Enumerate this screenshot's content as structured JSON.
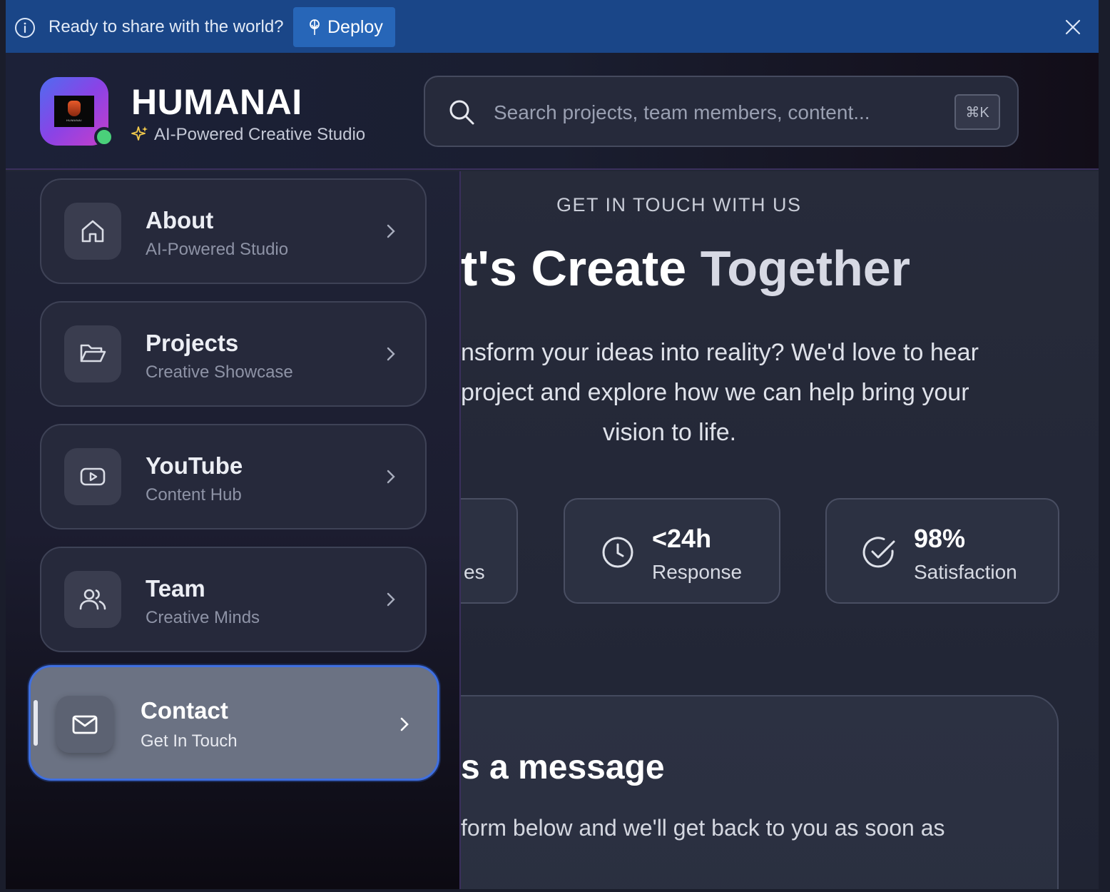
{
  "banner": {
    "text": "Ready to share with the world?",
    "deploy_label": "Deploy"
  },
  "header": {
    "brand_title": "HUMANAI",
    "brand_subtitle": "AI-Powered Creative Studio",
    "logo_text": "HUMANAI",
    "search_placeholder": "Search projects, team members, content...",
    "shortcut": "⌘K"
  },
  "sidebar": {
    "items": [
      {
        "label": "About",
        "sub": "AI-Powered Studio",
        "icon": "home-icon"
      },
      {
        "label": "Projects",
        "sub": "Creative Showcase",
        "icon": "folder-icon"
      },
      {
        "label": "YouTube",
        "sub": "Content Hub",
        "icon": "youtube-icon"
      },
      {
        "label": "Team",
        "sub": "Creative Minds",
        "icon": "users-icon"
      },
      {
        "label": "Contact",
        "sub": "Get In Touch",
        "icon": "mail-icon",
        "active": true
      }
    ]
  },
  "main": {
    "eyebrow": "GET IN TOUCH WITH US",
    "hero_title_a": "t's Create ",
    "hero_title_b": "Together",
    "hero_lines": [
      "nsform your ideas into reality? We'd love to hear",
      "project and explore how we can help bring your",
      "vision to life."
    ],
    "stats": [
      {
        "value": "",
        "label": "es"
      },
      {
        "value": "<24h",
        "label": "Response",
        "icon": "clock-icon"
      },
      {
        "value": "98%",
        "label": "Satisfaction",
        "icon": "check-circle-icon"
      }
    ],
    "form_title": "s a message",
    "form_text": "form below and we'll get back to you as soon as"
  },
  "colors": {
    "banner": "#1a4688",
    "deploy_button": "#2766b8",
    "status_dot": "#4ad07a",
    "active_border": "#3f6fe0"
  }
}
